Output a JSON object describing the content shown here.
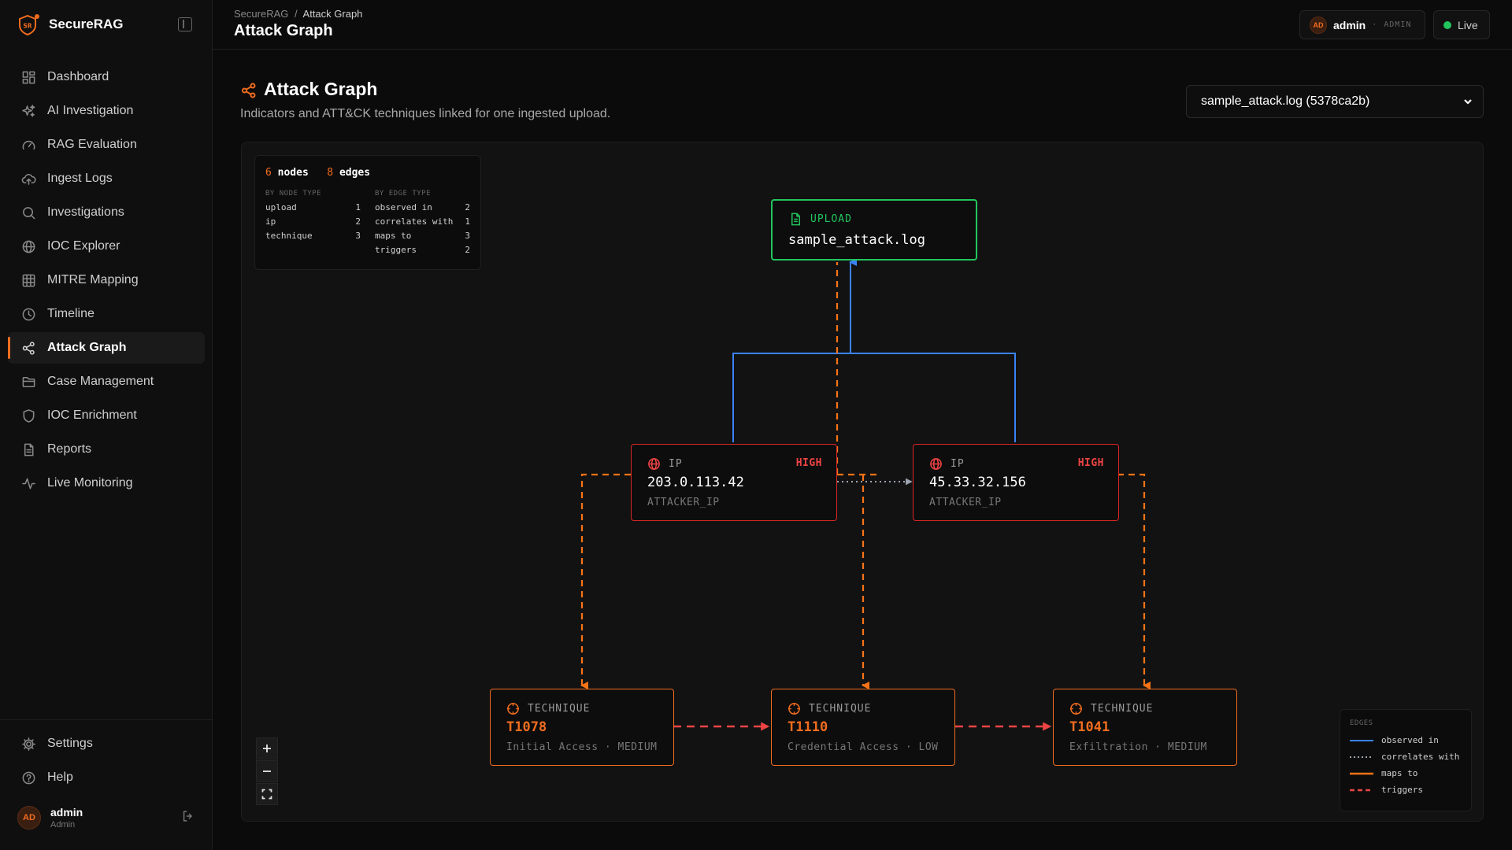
{
  "brand": {
    "name": "SecureRAG",
    "logo_text": "SR"
  },
  "nav": [
    {
      "label": "Dashboard",
      "icon": "dashboard-icon"
    },
    {
      "label": "AI Investigation",
      "icon": "sparkles-icon"
    },
    {
      "label": "RAG Evaluation",
      "icon": "gauge-icon"
    },
    {
      "label": "Ingest Logs",
      "icon": "upload-cloud-icon"
    },
    {
      "label": "Investigations",
      "icon": "search-icon"
    },
    {
      "label": "IOC Explorer",
      "icon": "globe-icon"
    },
    {
      "label": "MITRE Mapping",
      "icon": "grid-icon"
    },
    {
      "label": "Timeline",
      "icon": "clock-icon"
    },
    {
      "label": "Attack Graph",
      "icon": "share-icon",
      "active": true
    },
    {
      "label": "Case Management",
      "icon": "folder-icon"
    },
    {
      "label": "IOC Enrichment",
      "icon": "shield-icon"
    },
    {
      "label": "Reports",
      "icon": "file-icon"
    },
    {
      "label": "Live Monitoring",
      "icon": "activity-icon"
    }
  ],
  "bottom_nav": [
    {
      "label": "Settings",
      "icon": "gear-icon"
    },
    {
      "label": "Help",
      "icon": "help-icon"
    }
  ],
  "sidebar_user": {
    "initials": "AD",
    "name": "admin",
    "role": "Admin"
  },
  "topbar": {
    "breadcrumb_root": "SecureRAG",
    "breadcrumb_sep": "/",
    "breadcrumb_current": "Attack Graph",
    "title": "Attack Graph",
    "user_initials": "AD",
    "user_name": "admin",
    "user_role": "ADMIN",
    "live_label": "Live"
  },
  "page": {
    "title": "Attack Graph",
    "subtitle": "Indicators and ATT&CK techniques linked for one ingested upload.",
    "upload_selected": "sample_attack.log (5378ca2b)"
  },
  "stats": {
    "node_count": "6",
    "node_word": "nodes",
    "edge_count": "8",
    "edge_word": "edges",
    "by_node_header": "BY NODE TYPE",
    "by_edge_header": "BY EDGE TYPE",
    "node_types": [
      {
        "name": "upload",
        "count": "1"
      },
      {
        "name": "ip",
        "count": "2"
      },
      {
        "name": "technique",
        "count": "3"
      }
    ],
    "edge_types": [
      {
        "name": "observed in",
        "count": "2"
      },
      {
        "name": "correlates with",
        "count": "1"
      },
      {
        "name": "maps to",
        "count": "3"
      },
      {
        "name": "triggers",
        "count": "2"
      }
    ]
  },
  "nodes": {
    "upload": {
      "type": "UPLOAD",
      "label": "sample_attack.log"
    },
    "ip1": {
      "type": "IP",
      "severity": "HIGH",
      "label": "203.0.113.42",
      "sub": "ATTACKER_IP"
    },
    "ip2": {
      "type": "IP",
      "severity": "HIGH",
      "label": "45.33.32.156",
      "sub": "ATTACKER_IP"
    },
    "t1": {
      "type": "TECHNIQUE",
      "label": "T1078",
      "sub": "Initial Access · MEDIUM"
    },
    "t2": {
      "type": "TECHNIQUE",
      "label": "T1110",
      "sub": "Credential Access · LOW"
    },
    "t3": {
      "type": "TECHNIQUE",
      "label": "T1041",
      "sub": "Exfiltration · MEDIUM"
    }
  },
  "legend": {
    "header": "EDGES",
    "items": [
      "observed in",
      "correlates with",
      "maps to",
      "triggers"
    ]
  },
  "colors": {
    "accent": "#f26d1f",
    "observed": "#3b82f6",
    "correlates": "#9ca3af",
    "maps_to": "#f97316",
    "triggers": "#ef4444",
    "upload": "#22c55e",
    "live": "#22c55e"
  }
}
